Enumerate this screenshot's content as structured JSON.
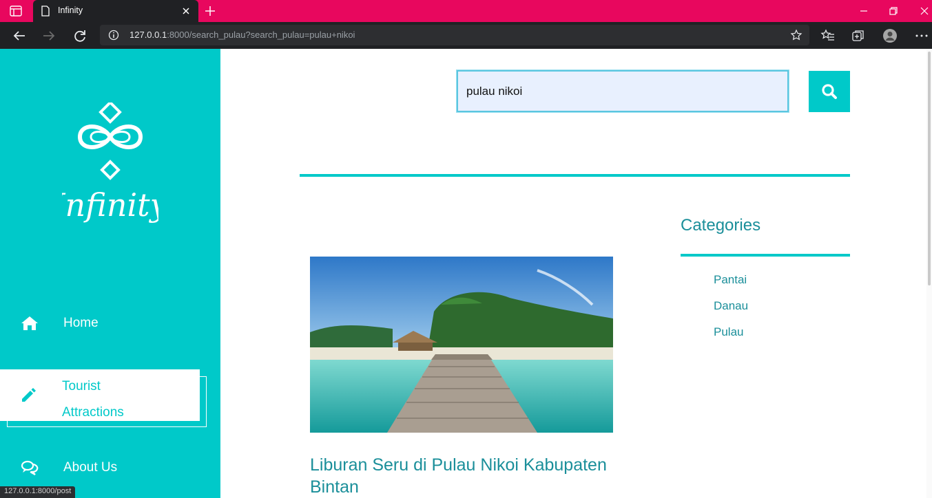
{
  "browser": {
    "tab_title": "Infinity",
    "url_host": "127.0.0.1",
    "url_rest": ":8000/search_pulau?search_pulau=pulau+nikoi",
    "status_url": "127.0.0.1:8000/post",
    "accent_color": "#e8075e"
  },
  "sidebar": {
    "logo_text": "Infinity",
    "color": "#00c9c9",
    "items": [
      {
        "icon": "home-icon",
        "label": "Home"
      },
      {
        "icon": "pencil-icon",
        "label_line1": "Tourist",
        "label_line2": "Attractions",
        "active": true
      },
      {
        "icon": "chat-icon",
        "label": "About Us"
      }
    ]
  },
  "search": {
    "value": "pulau nikoi",
    "button_icon": "search-icon"
  },
  "post": {
    "title": "Liburan Seru di Pulau Nikoi Kabupaten Bintan"
  },
  "categories": {
    "title": "Categories",
    "items": [
      "Pantai",
      "Danau",
      "Pulau"
    ]
  }
}
